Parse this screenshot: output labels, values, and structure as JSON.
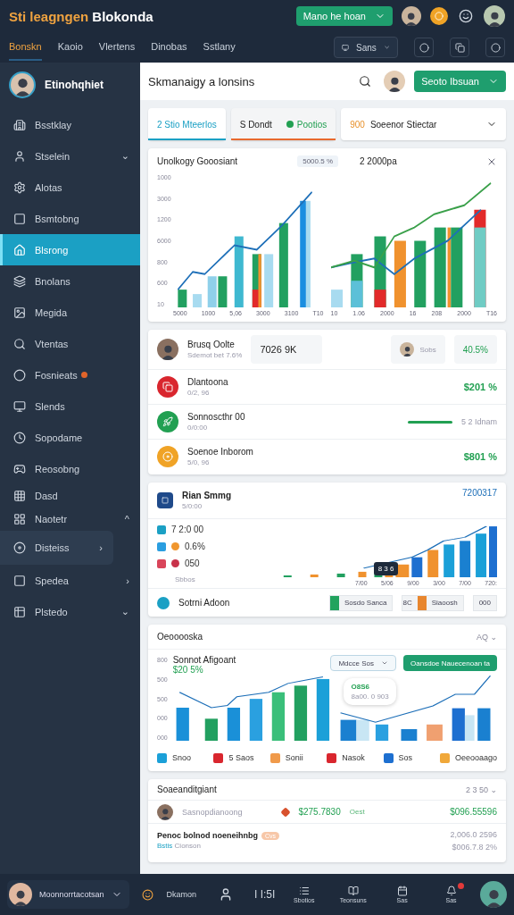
{
  "topbar": {
    "title_accent": "Sti leagngen",
    "title": "Blokonda",
    "primary_button": "Mano he hoan",
    "nav_tabs": [
      {
        "label": "Bonskn",
        "selected": true
      },
      {
        "label": "Kaoio",
        "selected": false
      },
      {
        "label": "Vlertens",
        "selected": false
      },
      {
        "label": "Dinobas",
        "selected": false
      },
      {
        "label": "Sstlany",
        "selected": false
      }
    ],
    "select": "Sans"
  },
  "sidebar": {
    "profile": "Etinohqhiet",
    "items": [
      {
        "label": "Bsstklay",
        "selected": false,
        "highlighted": false
      },
      {
        "label": "Stselein",
        "selected": false,
        "highlighted": false,
        "chevron": "⌄"
      },
      {
        "label": "Alotas",
        "selected": false,
        "highlighted": false
      },
      {
        "label": "Bsmtobng",
        "selected": false,
        "highlighted": false
      },
      {
        "label": "Blsrong",
        "selected": true,
        "highlighted": false
      },
      {
        "label": "Bnolans",
        "selected": false,
        "highlighted": false
      },
      {
        "label": "Megida",
        "selected": false,
        "highlighted": false
      },
      {
        "label": "Vtentas",
        "selected": false,
        "highlighted": false
      },
      {
        "label": "Fosnieats",
        "selected": false,
        "highlighted": false,
        "color": "#e0642a"
      },
      {
        "label": "Slends",
        "selected": false,
        "highlighted": false
      },
      {
        "label": "Sopodame",
        "selected": false,
        "highlighted": false
      },
      {
        "label": "Reosobng",
        "selected": false,
        "highlighted": false
      },
      {
        "label": "Dasd",
        "selected": false,
        "highlighted": false
      },
      {
        "label": "Naotetr",
        "selected": false,
        "highlighted": false,
        "chevron": "^"
      },
      {
        "label": "Disteiss",
        "selected": false,
        "highlighted": true,
        "chevron": "›"
      },
      {
        "label": "Spedea",
        "selected": false,
        "highlighted": false,
        "chevron": "›"
      },
      {
        "label": "Plstedo",
        "selected": false,
        "highlighted": false,
        "chevron": "⌄"
      }
    ]
  },
  "header": {
    "title": "Skmanaigy a lonsins",
    "button": "Seoto Ibsuan"
  },
  "tabs": [
    {
      "label": "2 Stio Mteerlos",
      "selected": true,
      "color": "#1ba0c4"
    },
    {
      "label": "S Dondt",
      "badge": "Pootios",
      "selected": false,
      "color": "#e8692e"
    }
  ],
  "filter": {
    "prefix": "900",
    "label": "Soeenor Stiectar"
  },
  "overview_card": {
    "title": "Unolkogy Gooosiant",
    "badge": "5000.5 %",
    "right_title": "2 2000pa",
    "y_labels": [
      "1000",
      "3000",
      "1200",
      "6000",
      "800",
      "600",
      "10"
    ],
    "left_x_labels": [
      "5000",
      "1000",
      "5,06",
      "3000",
      "3100",
      "T10"
    ],
    "right_x_labels": [
      "10",
      "1.06",
      "2000",
      "16",
      "208",
      "2000",
      "T16"
    ]
  },
  "accounts_card": {
    "profile": {
      "name": "Brusq Oolte",
      "sub": "Sdemot bet 7.6%"
    },
    "stat": "7026 9K",
    "user": "Sobs",
    "change": "40.5%",
    "rows": [
      {
        "kind": "value",
        "name": "Dlantoona",
        "sub": "0/2, 96",
        "value": "$201 %",
        "color": "#d9262e"
      },
      {
        "kind": "bar",
        "name": "Sonnoscthr 00",
        "sub": "0/0:00",
        "value": "5 2 Idnam",
        "color": "#22a052"
      },
      {
        "kind": "value",
        "name": "Soenoe Inborom",
        "sub": "5/0, 96",
        "value": "$801 %",
        "color": "#f0a326"
      }
    ]
  },
  "trend_card": {
    "title": "Rian Smmg",
    "sub": "5/0:00",
    "total": "7200317",
    "legend": [
      {
        "value": "7 2:0 00",
        "color": "#1ba0c4"
      },
      {
        "value": "0.6%",
        "color": "#2a9ee0",
        "marker": {
          "color": "#f0962e"
        }
      },
      {
        "value": "050",
        "color": "#d9455a",
        "marker": {
          "color": "#c8324a"
        }
      }
    ],
    "axis_label": "Sbbos",
    "x_labels": [
      "7/00",
      "5/06",
      "9/00",
      "3/00",
      "7/00",
      "720:"
    ],
    "tooltip": "8 3 6",
    "footer": {
      "label": "Sotrni Adoon",
      "chips": [
        {
          "label": "Sosdo Sanca",
          "color": "#22a35e"
        },
        {
          "prefix": "8C",
          "label": "Siaoosh",
          "color": "#e8862e"
        },
        {
          "label": "000"
        }
      ]
    }
  },
  "compare_card": {
    "title": "Oeooooska",
    "range": "AQ ⌄",
    "chart_title": "Sonnot Afigoant",
    "chart_value": "$20 5%",
    "y_labels": [
      "800",
      "500",
      "500",
      "000",
      "000"
    ],
    "select": "Mdcce Sos",
    "button": "Oansdoe Nauecenoan ta",
    "bubble": {
      "title": "O8S6",
      "text": "8a00. 0 903"
    },
    "legend": [
      {
        "label": "Snoo",
        "color": "#1ba0d8"
      },
      {
        "label": "5 Saos",
        "color": "#d9262e"
      },
      {
        "label": "Sonii",
        "color": "#f09a4a"
      },
      {
        "label": "Nasok",
        "color": "#d9262e"
      },
      {
        "label": "Sos",
        "color": "#1d6fd0"
      },
      {
        "label": "Oeeooaago",
        "color": "#f0a83a"
      }
    ]
  },
  "ledger_card": {
    "title": "Soaeanditgiant",
    "range": "2 3 50 ⌄",
    "first_row": {
      "name": "Sasnopdianoong",
      "amount": "$275.7830",
      "tag": "Oest",
      "total": "$096.55596"
    },
    "second_row": {
      "name": "Penoc bolnod noeneihnbg",
      "badge": "Cvs",
      "sub_accent": "Bstis",
      "sub": "Cionson",
      "value_1": "2,006.0 2596",
      "value_2": "$006.7.8 2%"
    }
  },
  "bottombar": {
    "user": "Moonnorrtacotsan",
    "coin_label": "Dkamon",
    "time": "I I:5I",
    "items": [
      {
        "label": "Sbotios"
      },
      {
        "label": "Teonsuns"
      },
      {
        "label": "Sas"
      },
      {
        "label": "Sas",
        "notify": true
      }
    ]
  }
}
